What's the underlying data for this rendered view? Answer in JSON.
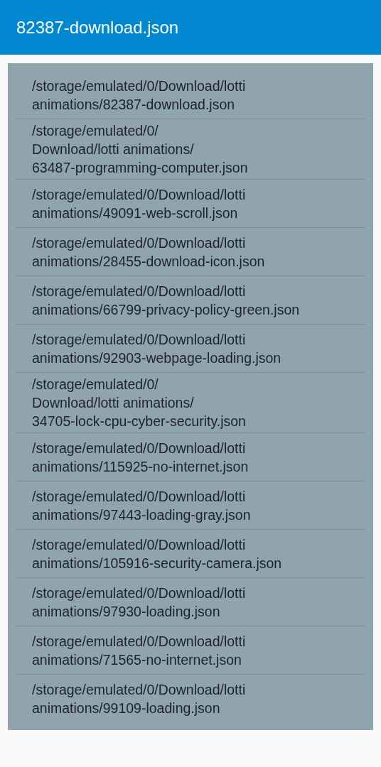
{
  "app_bar": {
    "title": "82387-download.json"
  },
  "files": [
    {
      "lines": [
        "/storage/emulated/0/Download/lotti",
        "animations/82387-download.json"
      ]
    },
    {
      "lines": [
        "/storage/emulated/0/",
        "Download/lotti animations/",
        "63487-programming-computer.json"
      ]
    },
    {
      "lines": [
        "/storage/emulated/0/Download/lotti",
        "animations/49091-web-scroll.json"
      ]
    },
    {
      "lines": [
        "/storage/emulated/0/Download/lotti",
        "animations/28455-download-icon.json"
      ]
    },
    {
      "lines": [
        "/storage/emulated/0/Download/lotti",
        "animations/66799-privacy-policy-green.json"
      ]
    },
    {
      "lines": [
        "/storage/emulated/0/Download/lotti",
        "animations/92903-webpage-loading.json"
      ]
    },
    {
      "lines": [
        "/storage/emulated/0/",
        "Download/lotti animations/",
        "34705-lock-cpu-cyber-security.json"
      ]
    },
    {
      "lines": [
        "/storage/emulated/0/Download/lotti",
        "animations/115925-no-internet.json"
      ]
    },
    {
      "lines": [
        "/storage/emulated/0/Download/lotti",
        "animations/97443-loading-gray.json"
      ]
    },
    {
      "lines": [
        "/storage/emulated/0/Download/lotti",
        "animations/105916-security-camera.json"
      ]
    },
    {
      "lines": [
        "/storage/emulated/0/Download/lotti",
        "animations/97930-loading.json"
      ]
    },
    {
      "lines": [
        "/storage/emulated/0/Download/lotti",
        "animations/71565-no-internet.json"
      ]
    },
    {
      "lines": [
        "/storage/emulated/0/Download/lotti",
        "animations/99109-loading.json"
      ]
    }
  ]
}
